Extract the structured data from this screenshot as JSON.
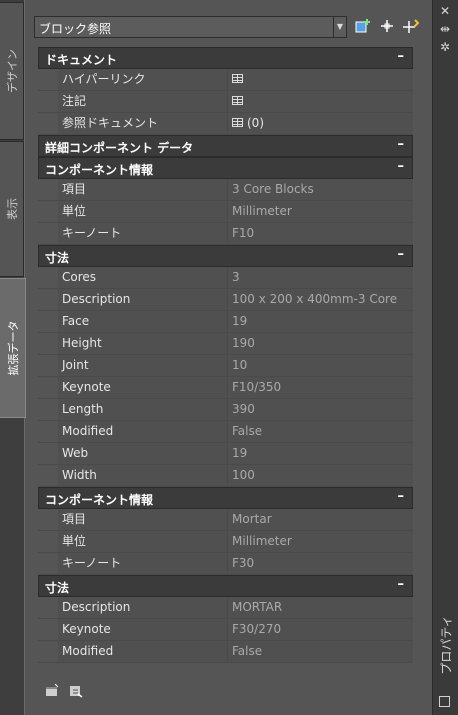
{
  "left_tabs": [
    "デザイン",
    "表示",
    "拡張データ"
  ],
  "active_tab": "拡張データ",
  "selector": {
    "value": "ブロック参照"
  },
  "toolbar": {
    "icons": [
      "add-to-selection-icon",
      "select-objects-icon",
      "quick-select-icon"
    ]
  },
  "palette_title": "プロパティ",
  "collapse_symbol": "–",
  "rows": [
    {
      "type": "cat",
      "label": "ドキュメント"
    },
    {
      "type": "prop",
      "name": "ハイパーリンク",
      "value": "",
      "icon": "table-icon",
      "white": true
    },
    {
      "type": "prop",
      "name": "注記",
      "value": "",
      "icon": "table-icon",
      "white": true
    },
    {
      "type": "prop",
      "name": "参照ドキュメント",
      "value": "(0)",
      "icon": "table-icon",
      "white": true
    },
    {
      "type": "cat",
      "label": "詳細コンポーネント データ"
    },
    {
      "type": "cat",
      "label": "コンポーネント情報"
    },
    {
      "type": "prop",
      "name": "項目",
      "value": "3 Core Blocks"
    },
    {
      "type": "prop",
      "name": "単位",
      "value": "Millimeter"
    },
    {
      "type": "prop",
      "name": "キーノート",
      "value": "F10"
    },
    {
      "type": "cat",
      "label": "寸法"
    },
    {
      "type": "prop",
      "name": "Cores",
      "value": "3"
    },
    {
      "type": "prop",
      "name": "Description",
      "value": "100 x 200 x 400mm-3 Core"
    },
    {
      "type": "prop",
      "name": "Face",
      "value": "19"
    },
    {
      "type": "prop",
      "name": "Height",
      "value": "190"
    },
    {
      "type": "prop",
      "name": "Joint",
      "value": "10"
    },
    {
      "type": "prop",
      "name": "Keynote",
      "value": "F10/350"
    },
    {
      "type": "prop",
      "name": "Length",
      "value": "390"
    },
    {
      "type": "prop",
      "name": "Modified",
      "value": "False"
    },
    {
      "type": "prop",
      "name": "Web",
      "value": "19"
    },
    {
      "type": "prop",
      "name": "Width",
      "value": "100"
    },
    {
      "type": "cat",
      "label": "コンポーネント情報"
    },
    {
      "type": "prop",
      "name": "項目",
      "value": "Mortar"
    },
    {
      "type": "prop",
      "name": "単位",
      "value": "Millimeter"
    },
    {
      "type": "prop",
      "name": "キーノート",
      "value": "F30"
    },
    {
      "type": "cat",
      "label": "寸法"
    },
    {
      "type": "prop",
      "name": "Description",
      "value": "MORTAR"
    },
    {
      "type": "prop",
      "name": "Keynote",
      "value": "F30/270"
    },
    {
      "type": "prop",
      "name": "Modified",
      "value": "False"
    }
  ],
  "bottom_icons": [
    "new-item-icon",
    "edit-icon"
  ]
}
